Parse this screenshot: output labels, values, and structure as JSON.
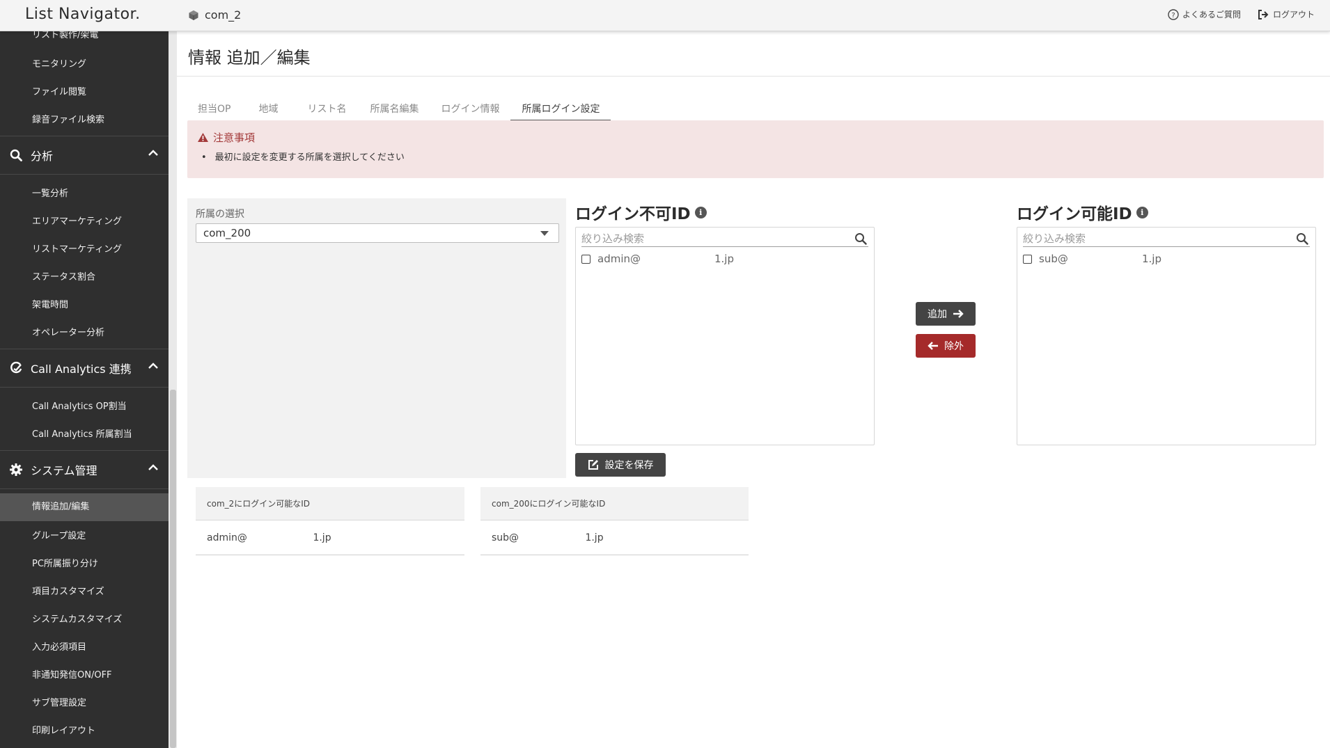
{
  "header": {
    "logo": "List Navigator.",
    "company": "com_2",
    "faq_label": "よくあるご質問",
    "logout_label": "ログアウト"
  },
  "sidebar": {
    "top_items": [
      {
        "label": "リスト製作/架電"
      },
      {
        "label": "モニタリング"
      },
      {
        "label": "ファイル閲覧"
      },
      {
        "label": "録音ファイル検索"
      }
    ],
    "sections": [
      {
        "label": "分析",
        "icon": "search-icon",
        "items": [
          "一覧分析",
          "エリアマーケティング",
          "リストマーケティング",
          "ステータス割合",
          "架電時間",
          "オペレーター分析"
        ]
      },
      {
        "label": "Call Analytics 連携",
        "icon": "call-analytics-icon",
        "items": [
          "Call Analytics OP割当",
          "Call Analytics 所属割当"
        ]
      },
      {
        "label": "システム管理",
        "icon": "gear-icon",
        "items": [
          "情報追加/編集",
          "グループ設定",
          "PC所属振り分け",
          "項目カスタマイズ",
          "システムカスタマイズ",
          "入力必須項目",
          "非通知発信ON/OFF",
          "サブ管理設定",
          "印刷レイアウト"
        ]
      }
    ],
    "active_item": "情報追加/編集"
  },
  "page": {
    "title": "情報 追加／編集",
    "tabs": [
      "担当OP",
      "地域",
      "リスト名",
      "所属名編集",
      "ログイン情報",
      "所属ログイン設定"
    ],
    "active_tab": "所属ログイン設定"
  },
  "alert": {
    "title": "注意事項",
    "message": "最初に設定を変更する所属を選択してください"
  },
  "affiliation": {
    "label": "所属の選択",
    "selected": "com_200"
  },
  "login_denied": {
    "title": "ログイン不可ID",
    "filter_placeholder": "絞り込み検索",
    "entries": [
      {
        "user": "admin@",
        "domain": "1.jp"
      }
    ]
  },
  "login_allowed": {
    "title": "ログイン可能ID",
    "filter_placeholder": "絞り込み検索",
    "entries": [
      {
        "user": "sub@",
        "domain": "1.jp"
      }
    ]
  },
  "buttons": {
    "add": "追加",
    "remove": "除外",
    "save": "設定を保存"
  },
  "tables": [
    {
      "header": "com_2にログイン可能なID",
      "rows": [
        {
          "user": "admin@",
          "domain": "1.jp"
        }
      ]
    },
    {
      "header": "com_200にログイン可能なID",
      "rows": [
        {
          "user": "sub@",
          "domain": "1.jp"
        }
      ]
    }
  ],
  "colors": {
    "sidebar_bg": "#2f2f2f",
    "active_item_bg": "#555555",
    "alert_bg": "#f4e4e4",
    "alert_text": "#a33a3a",
    "remove_button": "#a52a2a",
    "dark_button": "#444444"
  }
}
